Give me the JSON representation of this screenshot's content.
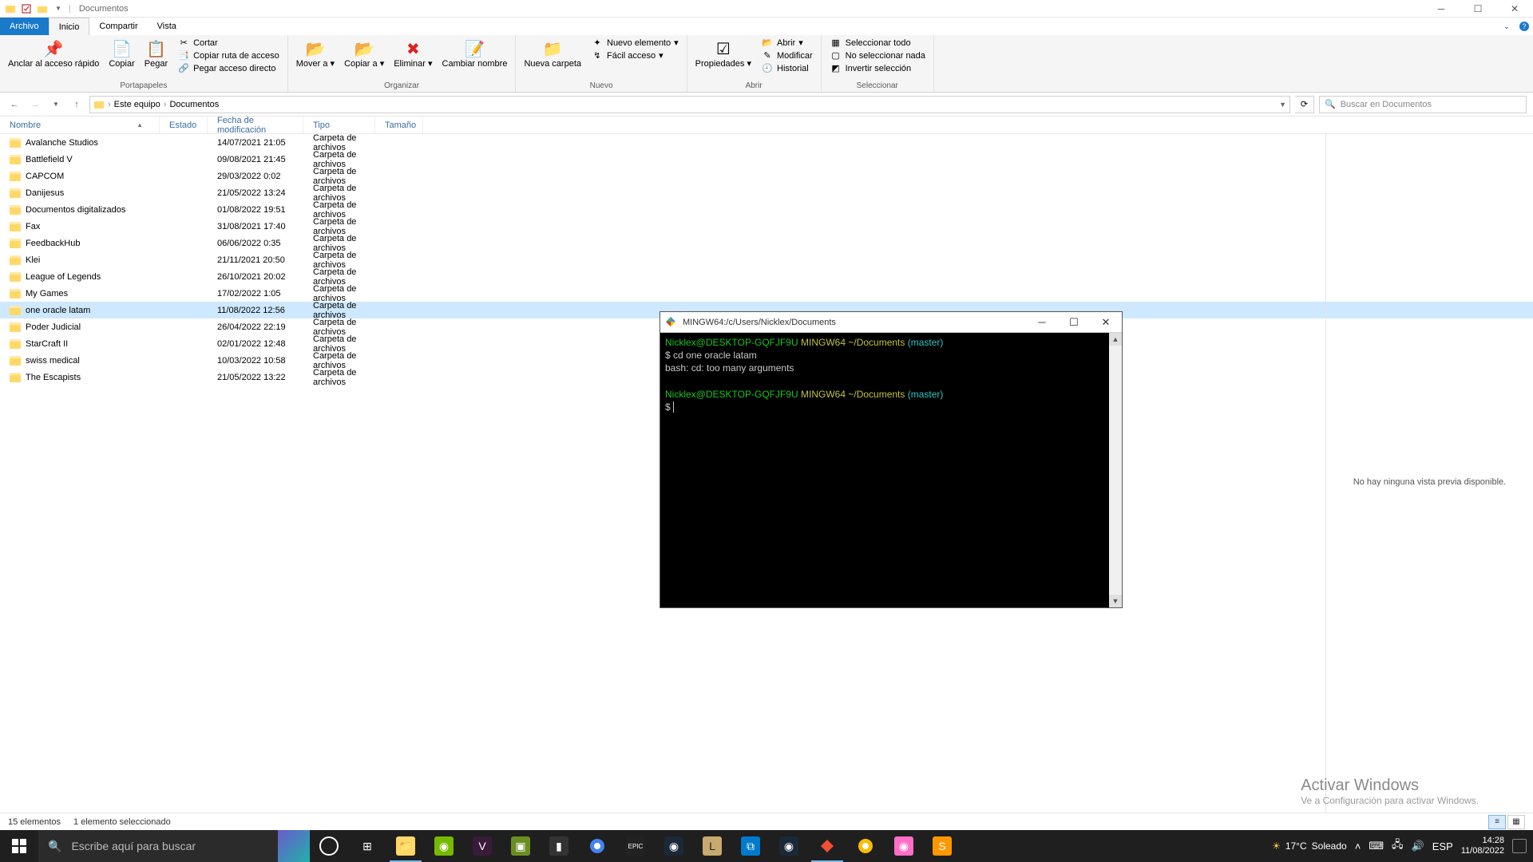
{
  "titlebar": {
    "title": "Documentos"
  },
  "tabs": {
    "file": "Archivo",
    "home": "Inicio",
    "share": "Compartir",
    "view": "Vista"
  },
  "ribbon": {
    "pin": "Anclar al acceso rápido",
    "copy": "Copiar",
    "paste": "Pegar",
    "cut": "Cortar",
    "copypath": "Copiar ruta de acceso",
    "pasteshortcut": "Pegar acceso directo",
    "grp_clipboard": "Portapapeles",
    "moveto": "Mover a",
    "copyto": "Copiar a",
    "delete": "Eliminar",
    "rename": "Cambiar nombre",
    "grp_organize": "Organizar",
    "newfolder": "Nueva carpeta",
    "newitem": "Nuevo elemento",
    "easyaccess": "Fácil acceso",
    "grp_new": "Nuevo",
    "properties": "Propiedades",
    "open": "Abrir",
    "edit": "Modificar",
    "history": "Historial",
    "grp_open": "Abrir",
    "selectall": "Seleccionar todo",
    "selectnone": "No seleccionar nada",
    "invert": "Invertir selección",
    "grp_select": "Seleccionar"
  },
  "breadcrumb": {
    "pc": "Este equipo",
    "docs": "Documentos"
  },
  "search_placeholder": "Buscar en Documentos",
  "columns": {
    "name": "Nombre",
    "state": "Estado",
    "date": "Fecha de modificación",
    "type": "Tipo",
    "size": "Tamaño"
  },
  "folder_type": "Carpeta de archivos",
  "files": [
    {
      "name": "Avalanche Studios",
      "date": "14/07/2021 21:05"
    },
    {
      "name": "Battlefield V",
      "date": "09/08/2021 21:45"
    },
    {
      "name": "CAPCOM",
      "date": "29/03/2022 0:02"
    },
    {
      "name": "Danijesus",
      "date": "21/05/2022 13:24"
    },
    {
      "name": "Documentos digitalizados",
      "date": "01/08/2022 19:51"
    },
    {
      "name": "Fax",
      "date": "31/08/2021 17:40"
    },
    {
      "name": "FeedbackHub",
      "date": "06/06/2022 0:35"
    },
    {
      "name": "Klei",
      "date": "21/11/2021 20:50"
    },
    {
      "name": "League of Legends",
      "date": "26/10/2021 20:02"
    },
    {
      "name": "My Games",
      "date": "17/02/2022 1:05"
    },
    {
      "name": "one oracle latam",
      "date": "11/08/2022 12:56",
      "selected": true
    },
    {
      "name": "Poder Judicial",
      "date": "26/04/2022 22:19"
    },
    {
      "name": "StarCraft II",
      "date": "02/01/2022 12:48"
    },
    {
      "name": "swiss medical",
      "date": "10/03/2022 10:58"
    },
    {
      "name": "The Escapists",
      "date": "21/05/2022 13:22"
    }
  ],
  "preview_msg": "No hay ninguna vista previa disponible.",
  "status": {
    "count": "15 elementos",
    "selected": "1 elemento seleccionado"
  },
  "watermark": {
    "title": "Activar Windows",
    "sub": "Ve a Configuración para activar Windows."
  },
  "terminal": {
    "title": "MINGW64:/c/Users/Nicklex/Documents",
    "user": "Nicklex@DESKTOP-GQFJF9U",
    "host": "MINGW64",
    "path": "~/Documents",
    "branch": "(master)",
    "cmd1": "cd one oracle latam",
    "err": "bash: cd: too many arguments",
    "prompt": "$"
  },
  "taskbar": {
    "search_placeholder": "Escribe aquí para buscar",
    "weather_temp": "17°C",
    "weather_cond": "Soleado",
    "lang": "ESP",
    "time": "14:28",
    "date": "11/08/2022"
  }
}
